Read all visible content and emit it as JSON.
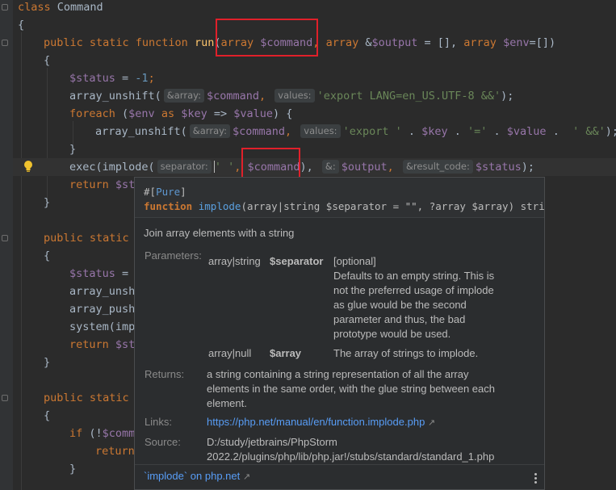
{
  "code": {
    "l1_kw": "class",
    "l1_name": "Command",
    "l2": "{",
    "l3_kw1": "public static function",
    "l3_fn": "run",
    "l3_p1": "(",
    "l3_type1": "array",
    "l3_v1": "$command",
    "l3_sep1": ", ",
    "l3_type2": "array",
    "l3_amp": " &",
    "l3_v2": "$output",
    "l3_eq": " = [], ",
    "l3_type3": "array",
    "l3_v3": "$env",
    "l3_end": "=[])",
    "l4": "{",
    "l5_v": "$status",
    "l5_eq": " = ",
    "l5_num": "-1",
    "l5_end": ";",
    "l6_fn": "array_unshift(",
    "l6_hint1": "&array:",
    "l6_v": "$command",
    "l6_c": ",",
    "l6_hint2": "values:",
    "l6_str": "'export LANG=en_US.UTF-8 &&'",
    "l6_end": ");",
    "l7_kw": "foreach",
    "l7_a": " (",
    "l7_v1": "$env",
    "l7_as": " as ",
    "l7_v2": "$key",
    "l7_arr": " => ",
    "l7_v3": "$value",
    "l7_end": ") {",
    "l8_fn": "array_unshift(",
    "l8_hint1": "&array:",
    "l8_v": "$command",
    "l8_c": ",",
    "l8_hint2": "values:",
    "l8_s1": "'export '",
    "l8_dot1": " . ",
    "l8_v2": "$key",
    "l8_dot2": " . ",
    "l8_s2": "'='",
    "l8_dot3": " . ",
    "l8_v3": "$value",
    "l8_dot4": " .  ",
    "l8_s3": "' &&'",
    "l8_end": ");",
    "l9": "}",
    "l10_fn": "exec(implode(",
    "l10_hint1": "separator:",
    "l10_s1": "' '",
    "l10_c1": ",",
    "l10_v1": "$command",
    "l10_p": "),",
    "l10_hint2": "&:",
    "l10_v2": "$output",
    "l10_c2": ",",
    "l10_hint3": "&result_code:",
    "l10_v3": "$status",
    "l10_end": ");",
    "l11_kw": "return",
    "l11_v": "$st",
    "l12": "}",
    "l13_kw": "public static",
    "l14": "{",
    "l15_v": "$status",
    "l15_eq": " =",
    "l16": "array_unsh",
    "l17": "array_push",
    "l18": "system(imp",
    "l19_kw": "return",
    "l19_v": "$st",
    "l20": "}",
    "l21_kw": "public static",
    "l22": "{",
    "l23_kw": "if",
    "l23_rest": " (!",
    "l23_v": "$comm",
    "l24_kw": "return",
    "l25": "}"
  },
  "popup": {
    "attr_open": "#[",
    "attr": "Pure",
    "attr_close": "]",
    "sig_kw": "function",
    "sig_name": "implode",
    "sig_rest": "(array|string $separator = \"\", ?array $array) string",
    "description": "Join array elements with a string",
    "params_label": "Parameters:",
    "p1_type": "array|string",
    "p1_name": "$separator",
    "p1_opt": "[optional]",
    "p1_desc": [
      "Defaults to an empty string. This is",
      "not the preferred usage of implode",
      "as glue would be the second",
      "parameter and thus, the bad",
      "prototype would be used."
    ],
    "p2_type": "array|null",
    "p2_name": "$array",
    "p2_desc": "The array of strings to implode.",
    "returns_label": "Returns:",
    "returns_desc": [
      "a string containing a string representation of all the array",
      "elements in the same order, with the glue string between each",
      "element."
    ],
    "links_label": "Links:",
    "link_url": "https://php.net/manual/en/function.implode.php",
    "source_label": "Source:",
    "source_path": [
      "D:/study/jetbrains/PhpStorm",
      "2022.2/plugins/php/lib/php.jar!/stubs/standard/standard_1.php"
    ],
    "footer_link": "`implode` on php.net"
  },
  "colors": {
    "keyword": "#cc7832",
    "function": "#ffc66d",
    "variable": "#9876aa",
    "string": "#6a8759",
    "number": "#6897bb",
    "highlight_box": "#e0202a",
    "link": "#589df6"
  }
}
